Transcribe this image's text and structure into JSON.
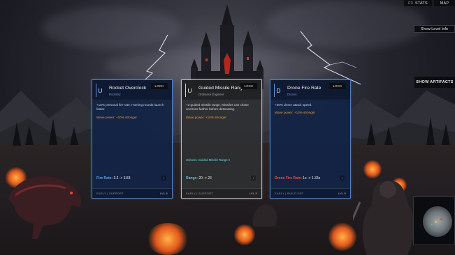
{
  "top_bar": {
    "stats_key": "F3",
    "stats_label": "STATS",
    "map_label": "MAP"
  },
  "level_info_button": "Show Level Info",
  "artifacts_button": "SHOW ARTIFACTS",
  "cards": [
    {
      "rarity_letter": "U",
      "title": "Rocket Overclock",
      "subtitle": "Rocketry",
      "lock_label": "LOCK",
      "description": "+10% personal fire rate. Homing rounds launch faster.",
      "wave_power": "Wave power: +10% stronger",
      "unlocks": "",
      "stat_label": "Fire Rate:",
      "stat_value": "3.2 -> 3.83",
      "page": "1",
      "tags": "EARLY | SUPPORT",
      "level": "LVL 5",
      "stat_color": "cool"
    },
    {
      "rarity_letter": "U",
      "title": "Guided Missile Range I",
      "subtitle": "Ordnance Engineer",
      "lock_label": "LOCK",
      "description": "+3 guided missile range. Missiles can chase enemies farther before detonating.",
      "wave_power": "Wave power: +16% stronger",
      "unlocks": "Unlocks: Guided Missile Range II",
      "stat_label": "Range:",
      "stat_value": "20 -> 23",
      "page": "1",
      "tags": "EARLY | SUPPORT",
      "level": "LVL 5",
      "stat_color": "cool"
    },
    {
      "rarity_letter": "D",
      "title": "Drone Fire Rate",
      "subtitle": "Drones",
      "lock_label": "LOCK",
      "description": "+30% drone attack speed.",
      "wave_power": "Wave power: +13% stronger",
      "unlocks": "",
      "stat_label": "Drone Fire Rate:",
      "stat_value": "1x -> 1.33x",
      "page": "1",
      "tags": "EARLY | BUILD-DEF",
      "level": "LVL 5",
      "stat_color": "warm"
    }
  ],
  "colors": {
    "card_blue_border": "#4f7fc6",
    "card_grey_border": "#b9bcc2",
    "wave_power": "#e2a23b",
    "unlocks": "#67d7e6",
    "ember": "#e2581c"
  },
  "minimap": {
    "markers": [
      "player-marker",
      "ally-marker",
      "enemy-marker"
    ]
  }
}
